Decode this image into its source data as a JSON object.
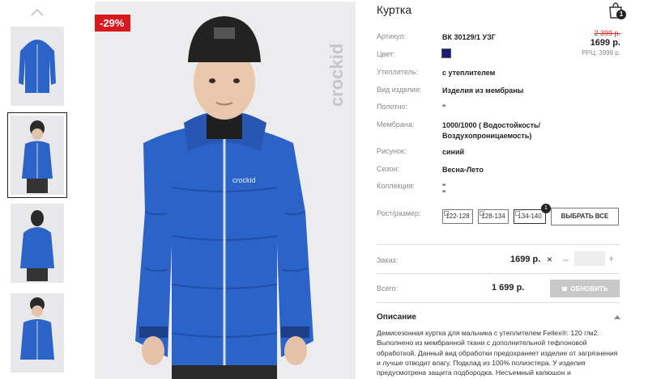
{
  "product": {
    "title": "Куртка",
    "discount_badge": "-29%",
    "brand_watermark": "crockid",
    "cart_count": "1"
  },
  "pricing": {
    "old_price": "2 399 р.",
    "new_price": "1699 р.",
    "rrp": "РРЦ: 3999 р."
  },
  "attributes": [
    {
      "label": "Артикул:",
      "value": "ВК 30129/1 УЗГ"
    },
    {
      "label": "Цвет:",
      "value": "",
      "swatch_color": "#1f1a7a"
    },
    {
      "label": "Утеплитель:",
      "value": "с утеплителем"
    },
    {
      "label": "Вид изделия:",
      "value": "Изделия из мембраны"
    },
    {
      "label": "Полотно:",
      "value": "\""
    },
    {
      "label": "Мембрана:",
      "value_line1": "1000/1000 ( Водостойкость/",
      "value_line2": "Воздухопроницаемость)"
    },
    {
      "label": "Рисунок:",
      "value": "синий"
    },
    {
      "label": "Сезон:",
      "value": "Весна-Лето"
    },
    {
      "label": "Коллекция:",
      "value_line1": "\"",
      "value_line2": "\""
    }
  ],
  "sizes": {
    "label": "Рост/размер:",
    "options": [
      {
        "label": "122-128"
      },
      {
        "label": "128-134"
      },
      {
        "label": "134-140",
        "badge": "1"
      }
    ],
    "select_all": "ВЫБРАТЬ ВСЕ"
  },
  "order": {
    "label": "Заказ:",
    "price": "1699 р.",
    "remove": "×",
    "minus": "–",
    "plus": "+",
    "quantity": ""
  },
  "total": {
    "label": "Всего:",
    "value": "1 699 р.",
    "update_button": "ОБНОВИТЬ"
  },
  "description": {
    "title": "Описание",
    "text": "Демисезонная куртка для мальчика с утеплителем Fellex®: 120 г/м2. Выполнено из мембранной ткани с дополнительной тефлоновой обработкой. Данный вид обработки предохраняет изделие от загрязнения и лучше отводит влагу. Подклад из 100% полиэстера. У изделия предусмотрена защита подбородка. Несъемный капюшон и"
  },
  "colors": {
    "jacket": "#2c63c9",
    "discount": "#d7191c",
    "photo_bg": "#ececee"
  }
}
